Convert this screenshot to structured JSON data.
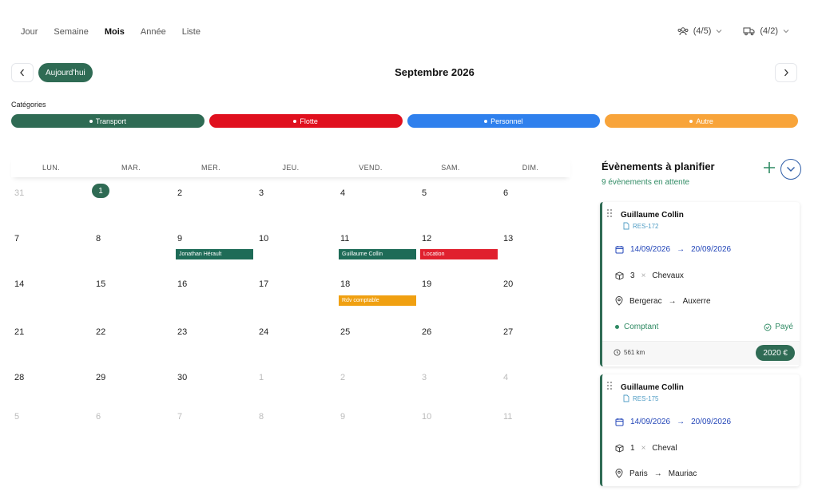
{
  "view_tabs": [
    "Jour",
    "Semaine",
    "Mois",
    "Année",
    "Liste"
  ],
  "active_view": "Mois",
  "filters": {
    "people": "(4/5)",
    "vehicles": "(4/2)"
  },
  "header": {
    "today": "Aujourd'hui",
    "month": "Septembre 2026"
  },
  "categories_label": "Catégories",
  "categories": [
    {
      "label": "Transport",
      "color": "#2f6b54"
    },
    {
      "label": "Flotte",
      "color": "#e0101e"
    },
    {
      "label": "Personnel",
      "color": "#2f80ed"
    },
    {
      "label": "Autre",
      "color": "#f8a43a"
    }
  ],
  "weekdays": [
    "LUN.",
    "MAR.",
    "MER.",
    "JEU.",
    "VEND.",
    "SAM.",
    "DIM."
  ],
  "weeks": [
    [
      "31",
      "1",
      "2",
      "3",
      "4",
      "5",
      "6"
    ],
    [
      "7",
      "8",
      "9",
      "10",
      "11",
      "12",
      "13"
    ],
    [
      "14",
      "15",
      "16",
      "17",
      "18",
      "19",
      "20"
    ],
    [
      "21",
      "22",
      "23",
      "24",
      "25",
      "26",
      "27"
    ],
    [
      "28",
      "29",
      "30",
      "1",
      "2",
      "3",
      "4"
    ],
    [
      "5",
      "6",
      "7",
      "8",
      "9",
      "10",
      "11"
    ]
  ],
  "events": [
    {
      "label": "Jonathan Hérault",
      "week": 1,
      "day": 2,
      "color": "#1e6b57"
    },
    {
      "label": "Guillaume Collin",
      "week": 1,
      "day": 4,
      "color": "#1e6b57"
    },
    {
      "label": "Location",
      "week": 1,
      "day": 5,
      "color": "#e0202e"
    },
    {
      "label": "Rdv comptable",
      "week": 2,
      "day": 4,
      "color": "#f0a011"
    }
  ],
  "side": {
    "title": "Évènements à planifier",
    "subtitle": "9 évènements en attente",
    "cards": [
      {
        "name": "Guillaume Collin",
        "ref": "RES-172",
        "date_from": "14/09/2026",
        "date_to": "20/09/2026",
        "qty": "3",
        "item": "Chevaux",
        "from": "Bergerac",
        "to": "Auxerre",
        "payment": "Comptant",
        "status": "Payé",
        "km": "561 km",
        "price": "2020 €"
      },
      {
        "name": "Guillaume Collin",
        "ref": "RES-175",
        "date_from": "14/09/2026",
        "date_to": "20/09/2026",
        "qty": "1",
        "item": "Cheval",
        "from": "Paris",
        "to": "Mauriac"
      }
    ]
  }
}
